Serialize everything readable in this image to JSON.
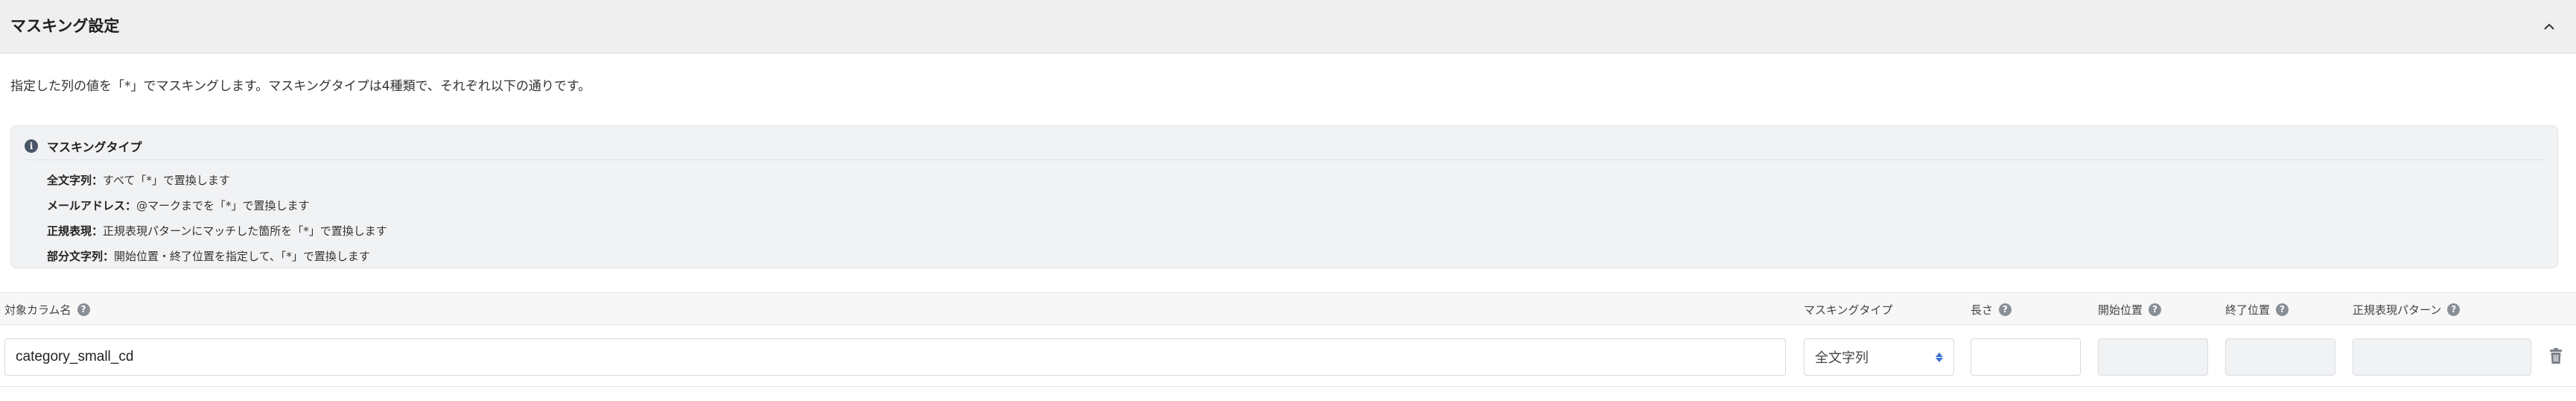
{
  "panel": {
    "title": "マスキング設定",
    "collapse_icon": "chevron-up-icon"
  },
  "description": "指定した列の値を「*」でマスキングします。マスキングタイプは4種類で、それぞれ以下の通りです。",
  "info": {
    "icon": "info-icon",
    "title": "マスキングタイプ",
    "items": [
      {
        "term": "全文字列：",
        "desc": "すべて「*」で置換します"
      },
      {
        "term": "メールアドレス：",
        "desc": "@マークまでを「*」で置換します"
      },
      {
        "term": "正規表現：",
        "desc": "正規表現パターンにマッチした箇所を「*」で置換します"
      },
      {
        "term": "部分文字列：",
        "desc": "開始位置・終了位置を指定して、「*」で置換します"
      }
    ]
  },
  "table": {
    "headers": {
      "column_name": "対象カラム名",
      "mask_type": "マスキングタイプ",
      "length": "長さ",
      "start": "開始位置",
      "end": "終了位置",
      "regex": "正規表現パターン"
    },
    "help_glyph": "?",
    "rows": [
      {
        "column_name": "category_small_cd",
        "mask_type": "全文字列",
        "length": "",
        "start": "",
        "end": "",
        "regex": ""
      }
    ]
  }
}
